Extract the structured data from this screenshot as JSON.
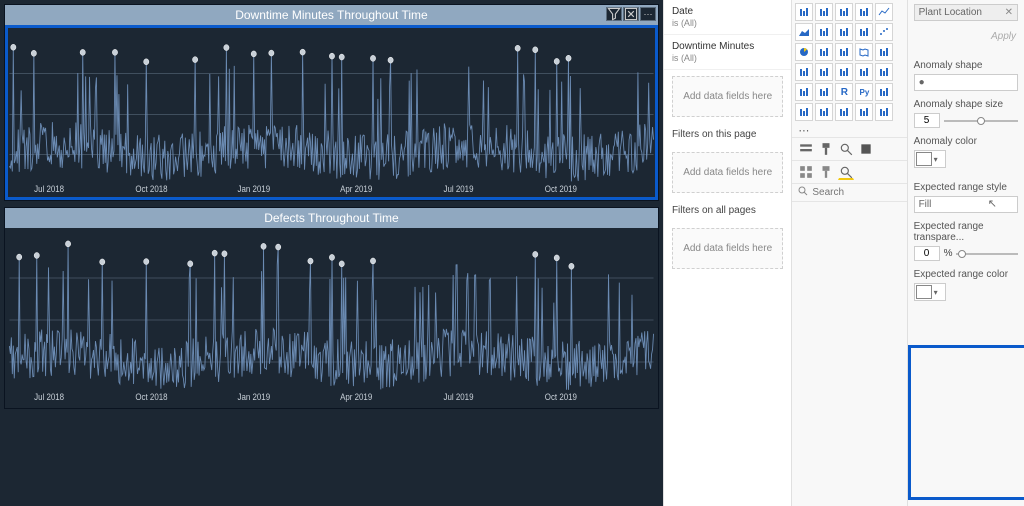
{
  "charts": [
    {
      "title": "Downtime Minutes Throughout Time",
      "selected": true,
      "tools": [
        "filter-icon",
        "focus-icon",
        "more-icon"
      ],
      "chart_data": {
        "type": "line",
        "xlabel": "",
        "ylabel": "",
        "categories": [
          "Jul 2018",
          "Oct 2018",
          "Jan 2019",
          "Apr 2019",
          "Jul 2019",
          "Oct 2019"
        ],
        "x_index_range": [
          0,
          660
        ],
        "series": [
          {
            "name": "Downtime Minutes",
            "anomaly_indices": [
              4,
              25,
              75,
              108,
              140,
              190,
              222,
              250,
              268,
              300,
              330,
              340,
              372,
              390,
              520,
              538,
              560,
              572
            ]
          }
        ]
      }
    },
    {
      "title": "Defects Throughout Time",
      "selected": false,
      "tools": [],
      "chart_data": {
        "type": "line",
        "xlabel": "",
        "ylabel": "",
        "categories": [
          "Jul 2018",
          "Oct 2018",
          "Jan 2019",
          "Apr 2019",
          "Jul 2019",
          "Oct 2019"
        ],
        "x_index_range": [
          0,
          660
        ],
        "series": [
          {
            "name": "Defects",
            "anomaly_indices": [
              10,
              28,
              60,
              95,
              140,
              185,
              210,
              220,
              260,
              275,
              308,
              330,
              340,
              372,
              538,
              560,
              575
            ]
          }
        ]
      }
    }
  ],
  "filters": {
    "visual": [
      {
        "field": "Date",
        "summary": "is (All)"
      },
      {
        "field": "Downtime Minutes",
        "summary": "is (All)"
      }
    ],
    "add_fields_label": "Add data fields here",
    "page_header": "Filters on this page",
    "allpages_header": "Filters on all pages"
  },
  "viz": {
    "search_placeholder": "Search",
    "field_chip": "Plant Location",
    "apply_label": "Apply"
  },
  "format": {
    "anomaly_shape_label": "Anomaly shape",
    "anomaly_shape_value": "●",
    "anomaly_size_label": "Anomaly shape size",
    "anomaly_size_value": "5",
    "anomaly_color_label": "Anomaly color",
    "range_style_label": "Expected range style",
    "range_style_value": "Fill",
    "range_trans_label": "Expected range transpare...",
    "range_trans_value": "0",
    "range_trans_unit": "%",
    "range_color_label": "Expected range color"
  }
}
